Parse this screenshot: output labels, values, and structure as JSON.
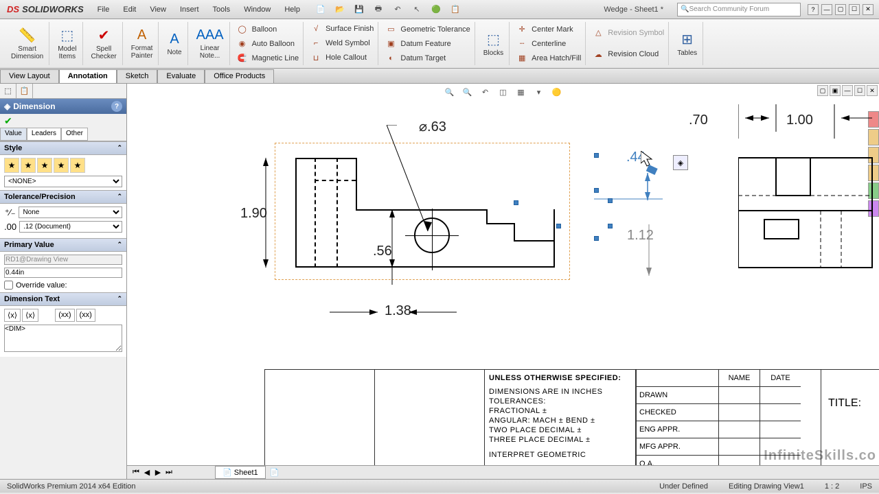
{
  "app": {
    "name": "SOLIDWORKS",
    "doc": "Wedge - Sheet1 *",
    "search_placeholder": "Search Community Forum"
  },
  "menu": {
    "file": "File",
    "edit": "Edit",
    "view": "View",
    "insert": "Insert",
    "tools": "Tools",
    "window": "Window",
    "help": "Help"
  },
  "ribbon": {
    "smart_dim": "Smart\nDimension",
    "model_items": "Model\nItems",
    "spell": "Spell\nChecker",
    "format": "Format\nPainter",
    "note": "Note",
    "linear_note": "Linear\nNote...",
    "blocks": "Blocks",
    "tables": "Tables",
    "col1": {
      "balloon": "Balloon",
      "auto_balloon": "Auto Balloon",
      "magnetic": "Magnetic Line"
    },
    "col2": {
      "surface": "Surface Finish",
      "weld": "Weld Symbol",
      "hole": "Hole Callout"
    },
    "col3": {
      "geo_tol": "Geometric Tolerance",
      "datum_f": "Datum Feature",
      "datum_t": "Datum Target"
    },
    "col4": {
      "center_mark": "Center Mark",
      "centerline": "Centerline",
      "hatch": "Area Hatch/Fill"
    },
    "col5": {
      "rev_sym": "Revision Symbol",
      "rev_cloud": "Revision Cloud"
    }
  },
  "tabs": {
    "view_layout": "View Layout",
    "annotation": "Annotation",
    "sketch": "Sketch",
    "evaluate": "Evaluate",
    "office": "Office Products"
  },
  "panel": {
    "title": "Dimension",
    "subtabs": {
      "value": "Value",
      "leaders": "Leaders",
      "other": "Other"
    },
    "style": {
      "head": "Style",
      "dropdown": "<NONE>"
    },
    "tol": {
      "head": "Tolerance/Precision",
      "type": "None",
      "prec": ".12 (Document)"
    },
    "pv": {
      "head": "Primary Value",
      "name": "RD1@Drawing View",
      "val": "0.44in",
      "override": "Override value:"
    },
    "dt": {
      "head": "Dimension Text",
      "content": "<DIM>"
    }
  },
  "dims": {
    "d1": "⌀.63",
    "d2": "1.90",
    "d3": ".56",
    "d4": "1.38",
    "d5": ".44",
    "d6": "1.12",
    "d7": ".70",
    "d8": "1.00"
  },
  "titleblock": {
    "spec_head": "UNLESS OTHERWISE SPECIFIED:",
    "l1": "DIMENSIONS ARE IN INCHES",
    "l2": "TOLERANCES:",
    "l3": "FRACTIONAL ±",
    "l4": "ANGULAR: MACH ±    BEND ±",
    "l5": "TWO PLACE DECIMAL   ±",
    "l6": "THREE PLACE DECIMAL  ±",
    "l7": "INTERPRET GEOMETRIC",
    "name": "NAME",
    "date": "DATE",
    "drawn": "DRAWN",
    "checked": "CHECKED",
    "eng": "ENG APPR.",
    "mfg": "MFG APPR.",
    "qa": "Q.A.",
    "title": "TITLE:"
  },
  "status": {
    "edition": "SolidWorks Premium 2014 x64 Edition",
    "under": "Under Defined",
    "editing": "Editing Drawing View1",
    "scale": "1 : 2",
    "ips": "IPS"
  },
  "sheet": "Sheet1",
  "watermark": "InfiniteSkills.co"
}
